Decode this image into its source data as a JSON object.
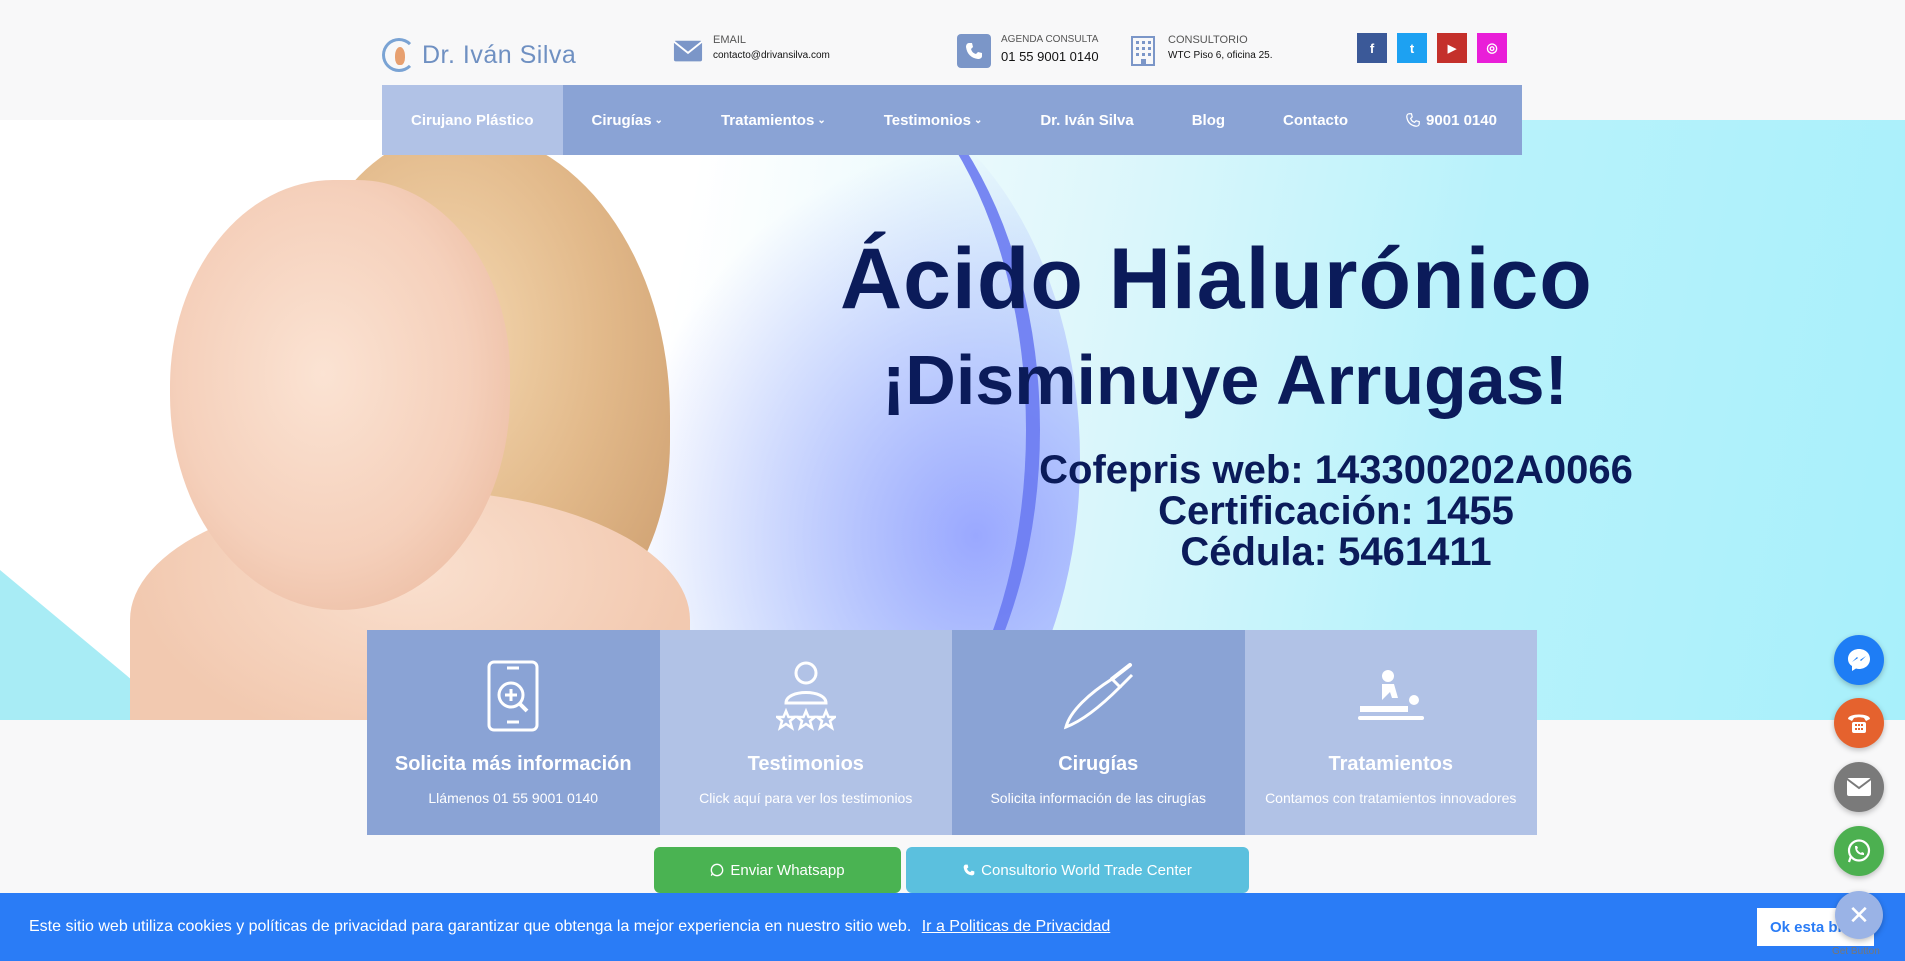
{
  "header": {
    "logo_text": "Dr. Iván Silva",
    "email": {
      "label": "EMAIL",
      "value": "contacto@drivansilva.com"
    },
    "agenda": {
      "label": "AGENDA CONSULTA",
      "value": "01 55 9001 0140"
    },
    "consultorio": {
      "label": "CONSULTORIO",
      "value": "WTC Piso 6, oficina 25."
    },
    "social": [
      {
        "name": "facebook",
        "glyph": "f",
        "color": "#3b5998"
      },
      {
        "name": "twitter",
        "glyph": "t",
        "color": "#1da1f2"
      },
      {
        "name": "youtube",
        "glyph": "▶",
        "color": "#c4302b"
      },
      {
        "name": "instagram",
        "glyph": "◎",
        "color": "#e91ed8"
      }
    ]
  },
  "nav": {
    "items": [
      {
        "label": "Cirujano Plástico",
        "caret": ""
      },
      {
        "label": "Cirugías",
        "caret": "⌄"
      },
      {
        "label": "Tratamientos",
        "caret": "⌄"
      },
      {
        "label": "Testimonios",
        "caret": "⌄"
      },
      {
        "label": "Dr. Iván Silva",
        "caret": ""
      },
      {
        "label": "Blog",
        "caret": ""
      },
      {
        "label": "Contacto",
        "caret": ""
      },
      {
        "label": "9001 0140",
        "caret": ""
      }
    ]
  },
  "hero": {
    "title": "Ácido Hialurónico",
    "subtitle": "¡Disminuye Arrugas!",
    "lines": [
      "Cofepris web: 143300202A0066",
      "Certificación: 1455",
      "Cédula: 5461411"
    ]
  },
  "cards": [
    {
      "title": "Solicita más información",
      "subtitle": "Llámenos 01 55 9001 0140"
    },
    {
      "title": "Testimonios",
      "subtitle": "Click aquí para ver los testimonios"
    },
    {
      "title": "Cirugías",
      "subtitle": "Solicita información de las cirugías"
    },
    {
      "title": "Tratamientos",
      "subtitle": "Contamos con tratamientos innovadores"
    }
  ],
  "buttons": {
    "whatsapp": "Enviar Whatsapp",
    "wtc": "Consultorio World Trade Center"
  },
  "cookie": {
    "message": "Este sitio web utiliza cookies y políticas de privacidad para garantizar que obtenga la mejor experiencia en nuestro sitio web.",
    "link": "Ir a Politicas de Privacidad",
    "ok": "Ok esta bien"
  },
  "widget": {
    "close": "✕",
    "get_button": "Get Button"
  },
  "colors": {
    "nav": "#8aa3d5",
    "nav_active": "#b1c2e6",
    "cookie_bar": "#2a7cf6",
    "whatsapp": "#4ab352",
    "wtc": "#5bc0de"
  }
}
